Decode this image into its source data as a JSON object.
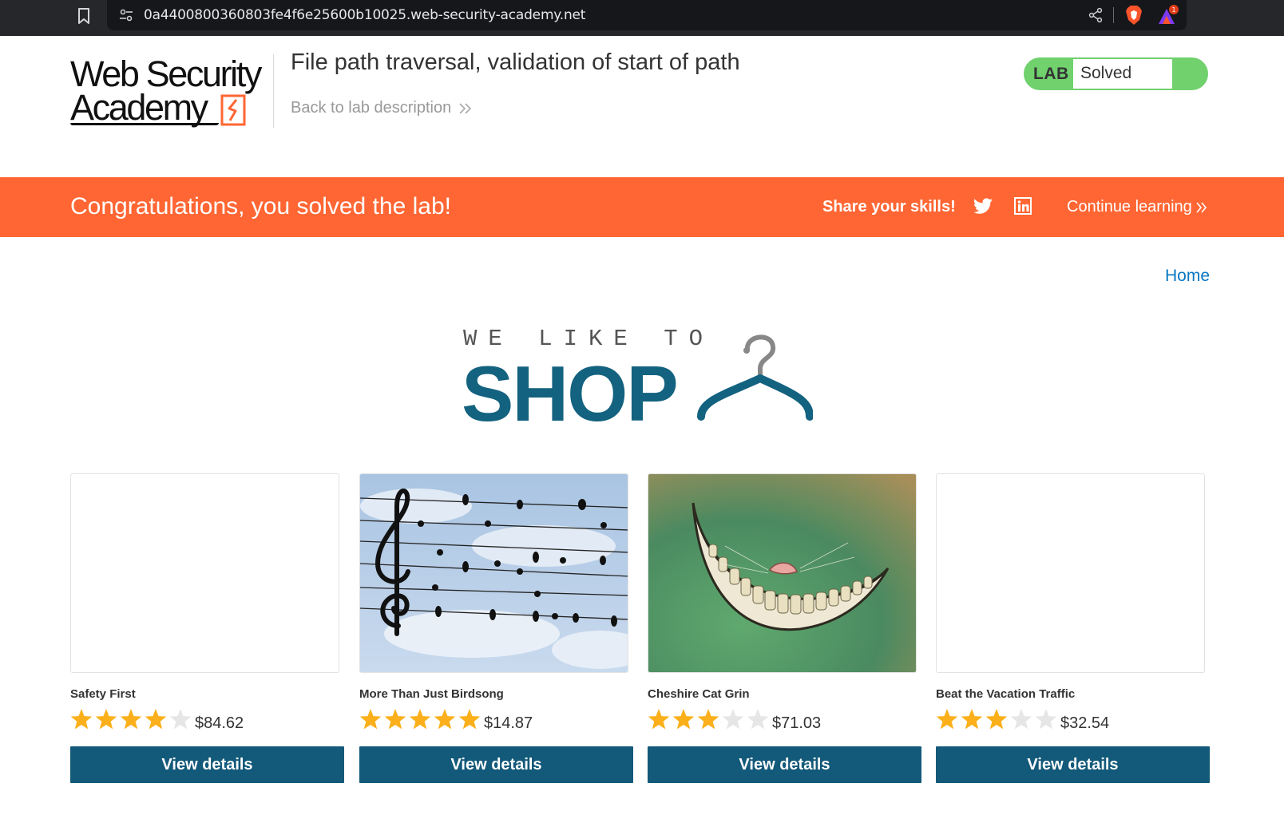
{
  "browser": {
    "url": "0a4400800360803fe4f6e25600b10025.web-security-academy.net",
    "notification_count": "1"
  },
  "header": {
    "logo_line1": "Web Security",
    "logo_line2": "Academy",
    "lab_title": "File path traversal, validation of start of path",
    "back_link": "Back to lab description",
    "status_label": "LAB",
    "status_value": "Solved"
  },
  "banner": {
    "message": "Congratulations, you solved the lab!",
    "share_label": "Share your skills!",
    "continue_label": "Continue learning"
  },
  "nav": {
    "home": "Home"
  },
  "shop_logo": {
    "tagline": "WE LIKE TO",
    "word": "SHOP"
  },
  "products": [
    {
      "name": "Safety First",
      "rating": 4,
      "price": "$84.62",
      "button": "View details",
      "image": "blank"
    },
    {
      "name": "More Than Just Birdsong",
      "rating": 5,
      "price": "$14.87",
      "button": "View details",
      "image": "music-birds"
    },
    {
      "name": "Cheshire Cat Grin",
      "rating": 3,
      "price": "$71.03",
      "button": "View details",
      "image": "cat-grin"
    },
    {
      "name": "Beat the Vacation Traffic",
      "rating": 3,
      "price": "$32.54",
      "button": "View details",
      "image": "blank"
    }
  ],
  "colors": {
    "banner": "#ff6633",
    "button": "#13597a",
    "lab_status": "#70d16d",
    "star": "#fbb01b",
    "star_empty": "#e6e6e6",
    "link": "#0a77c2"
  }
}
